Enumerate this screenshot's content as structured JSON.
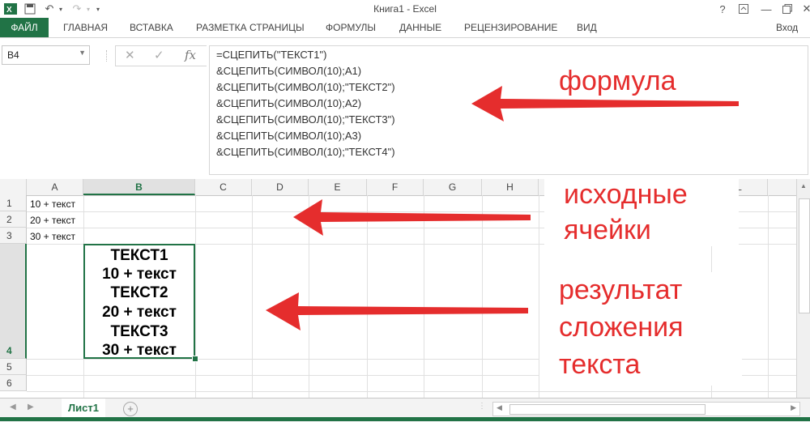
{
  "window": {
    "title": "Книга1 - Excel",
    "help": "?",
    "sign_in": "Вход"
  },
  "ribbon": {
    "tabs": [
      "ФАЙЛ",
      "ГЛАВНАЯ",
      "ВСТАВКА",
      "РАЗМЕТКА СТРАНИЦЫ",
      "ФОРМУЛЫ",
      "ДАННЫЕ",
      "РЕЦЕНЗИРОВАНИЕ",
      "ВИД"
    ]
  },
  "formula_bar": {
    "name_box": "B4",
    "fx": "fx",
    "lines": [
      "=СЦЕПИТЬ(\"ТЕКСТ1\")",
      "&СЦЕПИТЬ(СИМВОЛ(10);A1)",
      "&СЦЕПИТЬ(СИМВОЛ(10);\"ТЕКСТ2\")",
      "&СЦЕПИТЬ(СИМВОЛ(10);A2)",
      "&СЦЕПИТЬ(СИМВОЛ(10);\"ТЕКСТ3\")",
      "&СЦЕПИТЬ(СИМВОЛ(10);A3)",
      "&СЦЕПИТЬ(СИМВОЛ(10);\"ТЕКСТ4\")"
    ]
  },
  "grid": {
    "columns": [
      "A",
      "B",
      "C",
      "D",
      "E",
      "F",
      "G",
      "H",
      "L"
    ],
    "rows": [
      "1",
      "2",
      "3",
      "4",
      "5",
      "6"
    ],
    "cells_a": [
      "10 + текст",
      "20 + текст",
      "30 + текст"
    ],
    "b4_lines": [
      "ТЕКСТ1",
      "10 + текст",
      "ТЕКСТ2",
      "20 + текст",
      "ТЕКСТ3",
      "30 + текст"
    ]
  },
  "annotations": {
    "formula": "формула",
    "source_1": "исходные",
    "source_2": "ячейки",
    "result_1": "результат",
    "result_2": "сложения",
    "result_3": "текста",
    "color": "#e52d2d"
  },
  "sheets": {
    "active": "Лист1"
  },
  "colors": {
    "excel_green": "#217346"
  }
}
